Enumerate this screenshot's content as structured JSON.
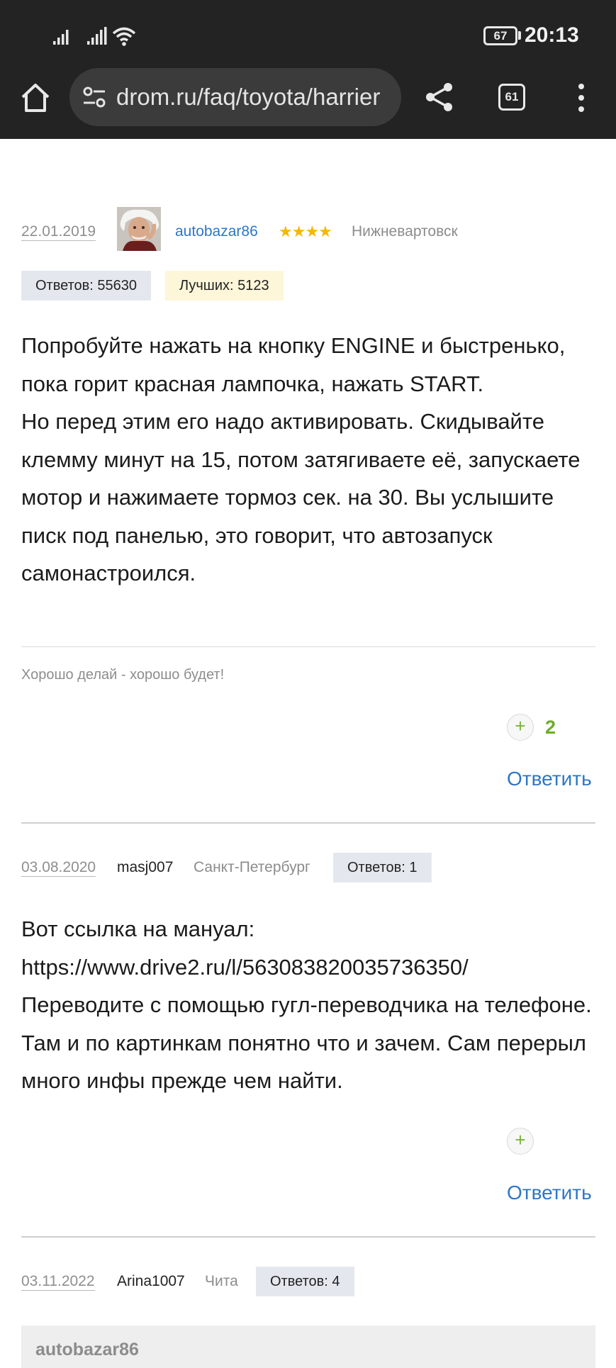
{
  "status_bar": {
    "battery": "67",
    "time": "20:13"
  },
  "browser": {
    "url": "drom.ru/faq/toyota/harrier",
    "tab_count": "61"
  },
  "answers": [
    {
      "date": "22.01.2019",
      "user": "autobazar86",
      "stars": "★★★★",
      "city": "Нижневартовск",
      "answers_count": "Ответов: 55630",
      "best_count": "Лучших: 5123",
      "paragraphs": [
        "Попробуйте нажать на кнопку ENGINE и быстренько, пока горит красная лампочка, нажать START.",
        "Но перед этим его надо активировать. Скидывайте клемму минут на 15, потом затягиваете её, запускаете мотор и нажимаете тормоз сек. на 30. Вы услышите писк под панелью, это говорит, что автозапуск самонастроился."
      ],
      "signature": "Хорошо делай - хорошо будет!",
      "plus": "+",
      "votes": "2",
      "reply": "Ответить"
    },
    {
      "date": "03.08.2020",
      "user": "masj007",
      "city": "Санкт-Петербург",
      "answers_count": "Ответов: 1",
      "paragraphs": [
        "Вот ссылка на мануал:",
        "https://www.drive2.ru/l/563083820035736350/",
        "Переводите с помощью гугл-переводчика на телефоне. Там и по картинкам понятно что и зачем. Сам перерыл много инфы прежде чем найти."
      ],
      "plus": "+",
      "reply": "Ответить"
    },
    {
      "date": "03.11.2022",
      "user": "Arina1007",
      "city": "Чита",
      "answers_count": "Ответов: 4",
      "quote_user": "autobazar86"
    }
  ],
  "colors": {
    "link": "#2e77c4",
    "vote_green": "#6eab2b",
    "chrome_bg": "#232323",
    "star": "#f4b800"
  }
}
